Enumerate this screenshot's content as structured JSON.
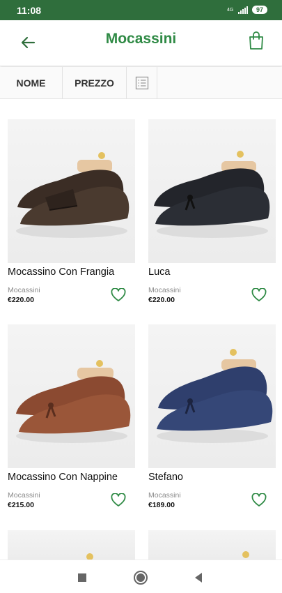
{
  "status_bar": {
    "time": "11:08",
    "network": "4G",
    "battery": "97"
  },
  "header": {
    "title": "Mocassini"
  },
  "sort": {
    "name_label": "NOME",
    "price_label": "PREZZO"
  },
  "products": [
    {
      "name": "Mocassino Con Frangia",
      "category": "Mocassini",
      "price": "€220.00",
      "color": "#3b2d25"
    },
    {
      "name": "Luca",
      "category": "Mocassini",
      "price": "€220.00",
      "color": "#23252b"
    },
    {
      "name": "Mocassino Con Nappine",
      "category": "Mocassini",
      "price": "€215.00",
      "color": "#8b4a31"
    },
    {
      "name": "Stefano",
      "category": "Mocassini",
      "price": "€189.00",
      "color": "#2f3f6d"
    },
    {
      "name": "",
      "category": "",
      "price": "",
      "color": "#efefef"
    },
    {
      "name": "",
      "category": "",
      "price": "",
      "color": "#efefef"
    }
  ],
  "colors": {
    "brand_green": "#2f8a45",
    "status_green": "#2f6e3c"
  },
  "icons": {
    "back": "arrow-left-icon",
    "cart": "shopping-bag-icon",
    "view": "list-view-icon",
    "favorite": "heart-icon"
  }
}
